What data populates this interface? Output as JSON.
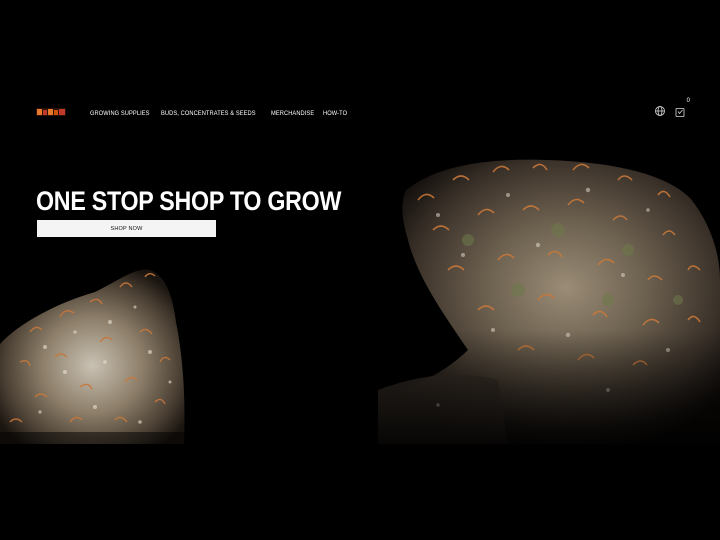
{
  "header": {
    "logo_name": "brand-logo",
    "nav": [
      {
        "label": "Growing Supplies"
      },
      {
        "label": "Buds, Concentrates & Seeds"
      },
      {
        "label": "Merchandise"
      },
      {
        "label": "How-To"
      }
    ],
    "icons": {
      "language": "globe-icon",
      "cart": "cart-icon"
    },
    "cart_count": "0"
  },
  "hero": {
    "title": "ONE STOP SHOP TO GROW",
    "cta_label": "SHOP NOW",
    "images": [
      "cannabis-bud-left",
      "cannabis-bud-right"
    ]
  },
  "colors": {
    "background": "#000000",
    "button_bg": "#f4f4f4",
    "button_text": "#111111",
    "logo_orange": "#e8782a",
    "logo_red": "#c0392b",
    "bud_orange": "#c8783a",
    "bud_green": "#6d7a4a",
    "bud_frost": "#d8d2c8"
  }
}
